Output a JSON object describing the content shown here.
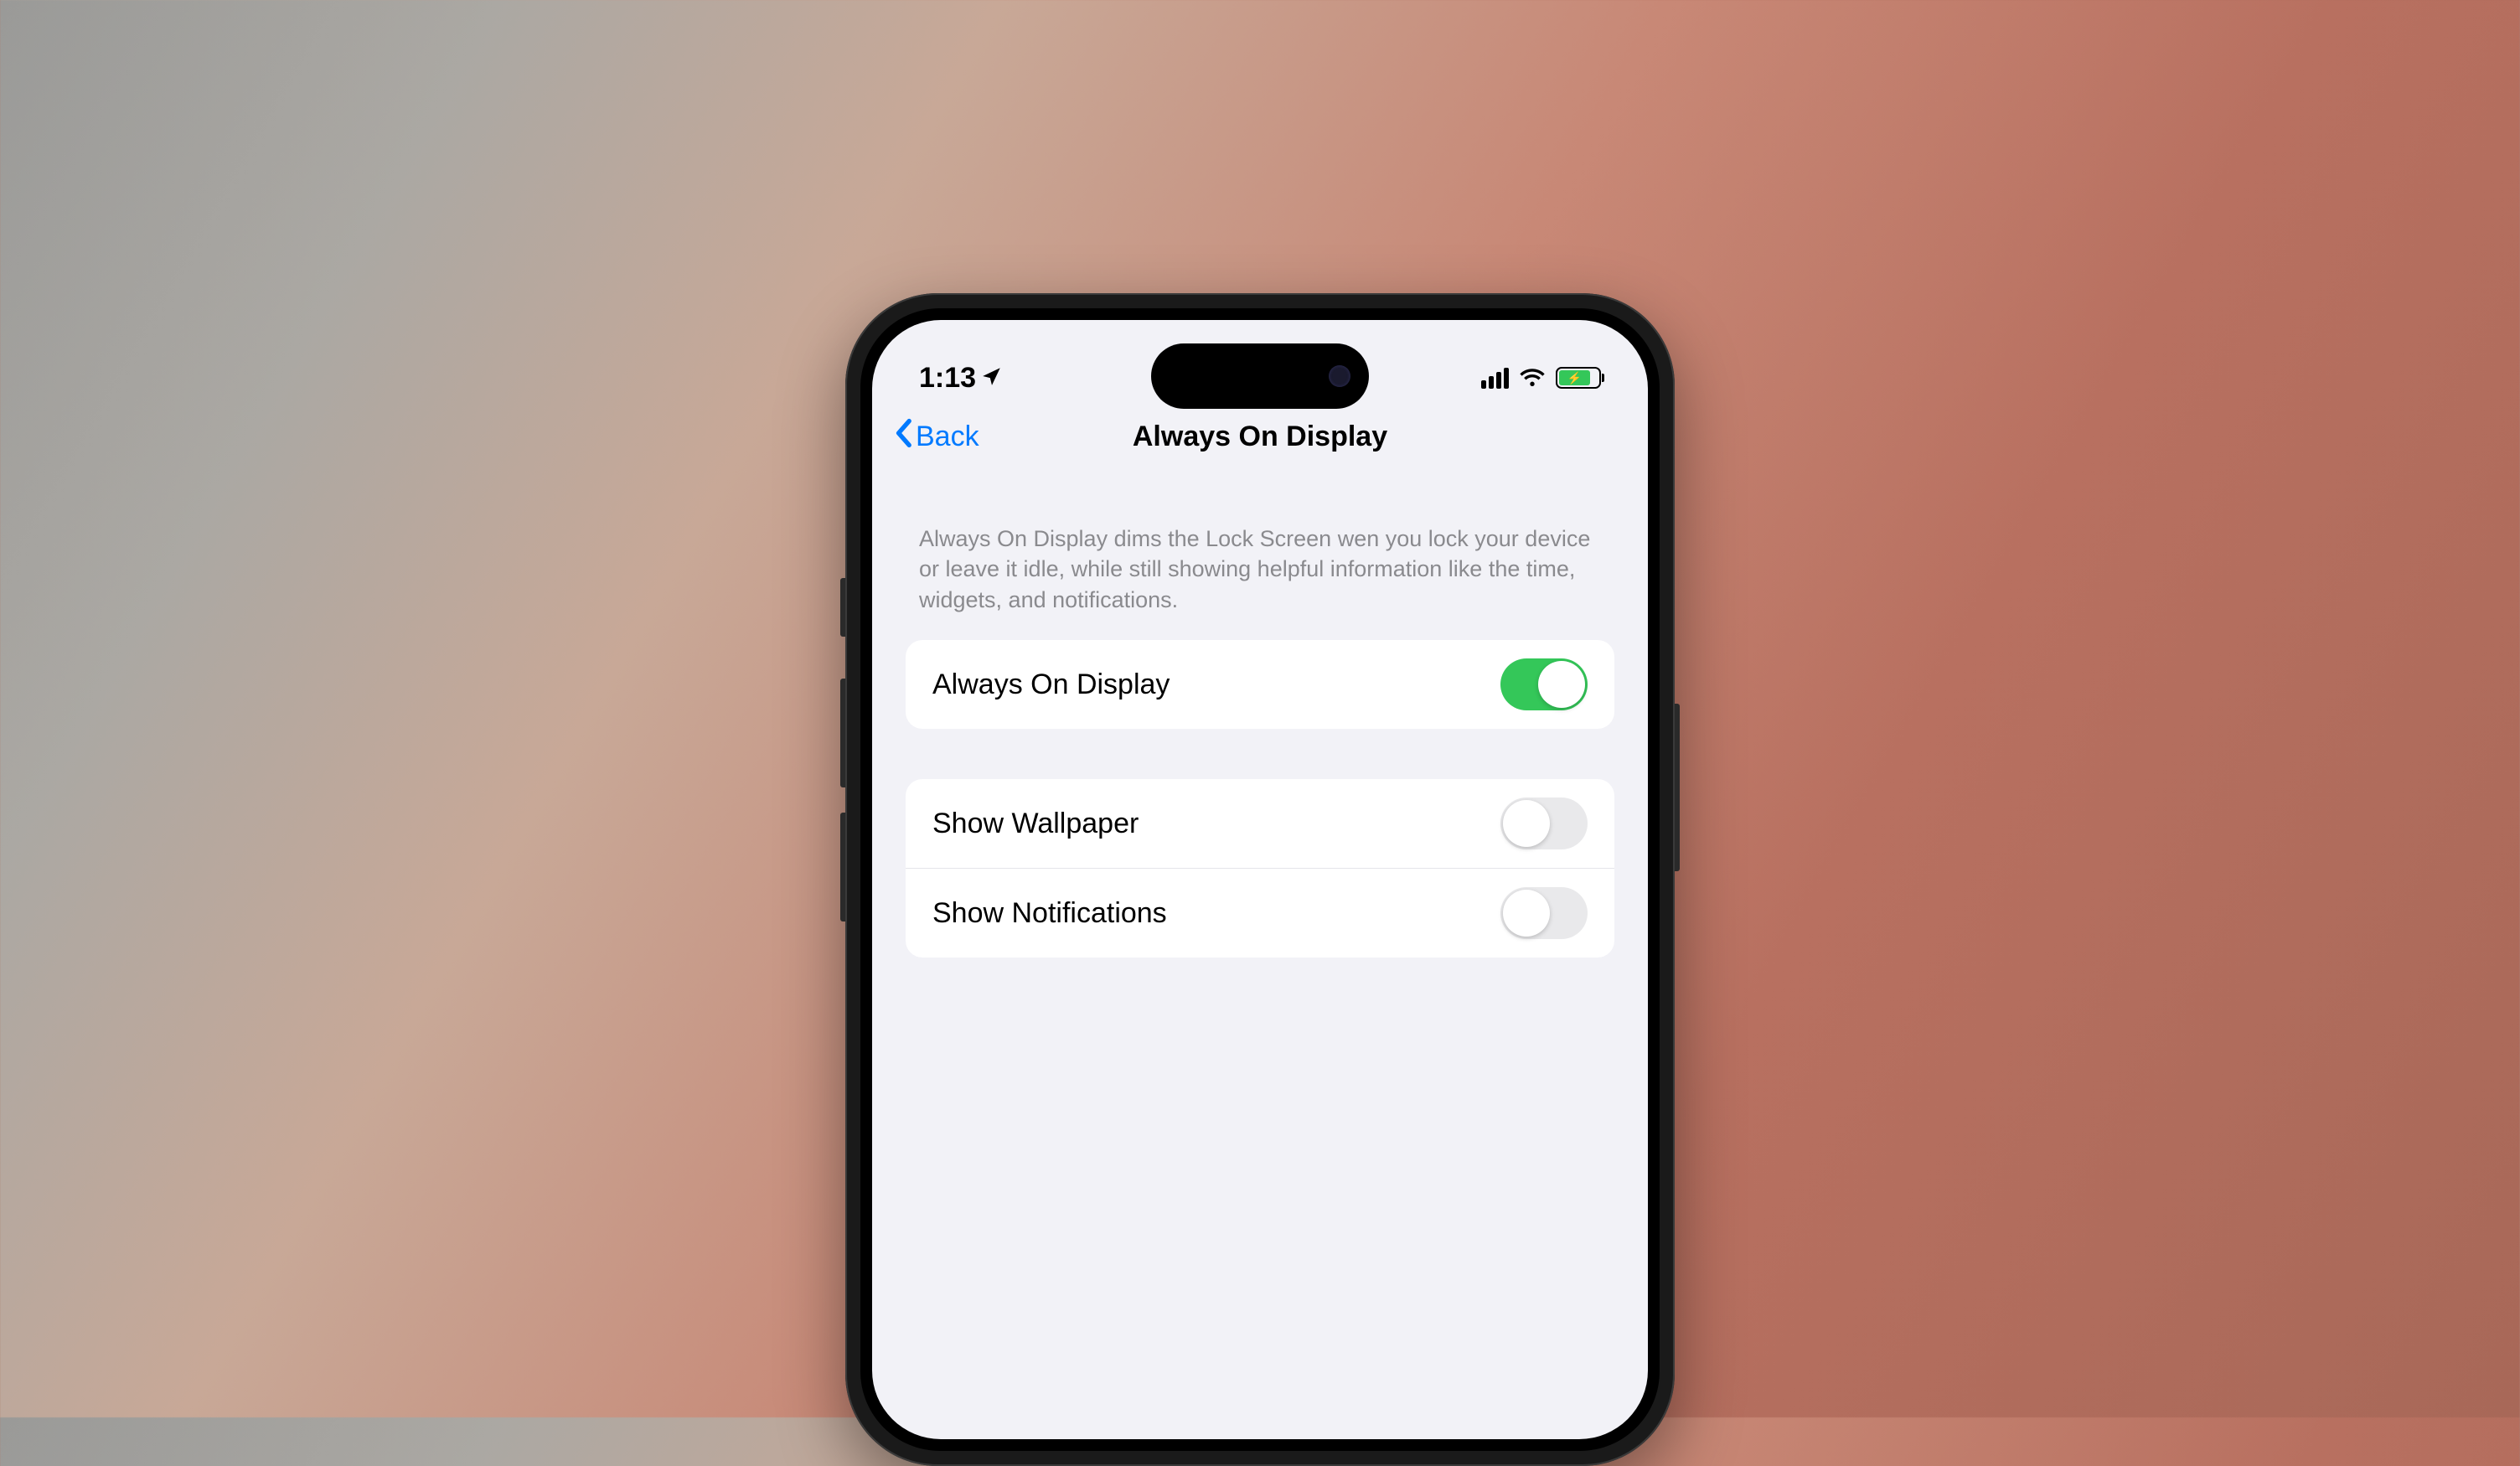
{
  "statusBar": {
    "time": "1:13"
  },
  "nav": {
    "back": "Back",
    "title": "Always On Display"
  },
  "description": "Always On Display dims the Lock Screen wen you lock your device or leave it idle, while still showing helpful information like the time, widgets, and notifications.",
  "settings": {
    "group1": [
      {
        "label": "Always On Display",
        "enabled": true
      }
    ],
    "group2": [
      {
        "label": "Show Wallpaper",
        "enabled": false
      },
      {
        "label": "Show Notifications",
        "enabled": false
      }
    ]
  },
  "colors": {
    "link": "#007aff",
    "toggleOn": "#34c759",
    "toggleOff": "#e9e9eb",
    "background": "#f2f2f7"
  }
}
